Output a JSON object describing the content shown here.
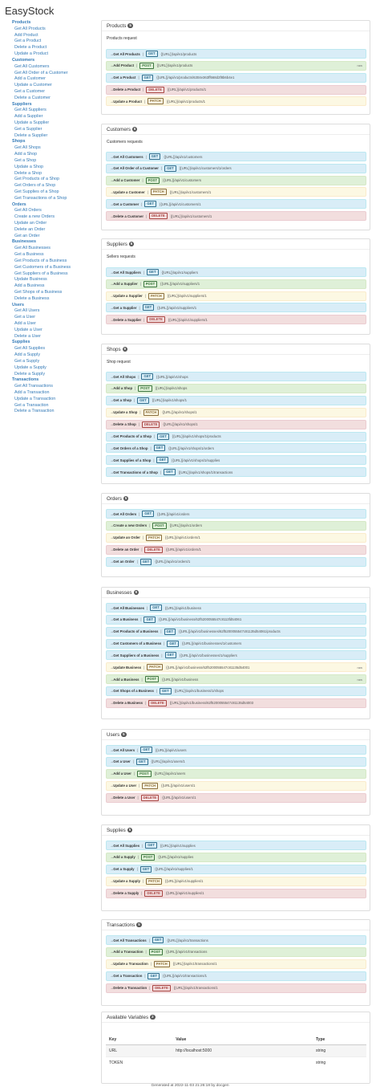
{
  "app_title": "EasyStock",
  "sidebar": [
    {
      "category": "Products",
      "items": [
        "Get All Products",
        "Add Product",
        "Get a Product",
        "Delete a Product",
        "Update a Product"
      ]
    },
    {
      "category": "Customers",
      "items": [
        "Get All Customers",
        "Get All Order of a Customer",
        "Add a Customer",
        "Update a Customer",
        "Get a Customer",
        "Delete a Customer"
      ]
    },
    {
      "category": "Suppliers",
      "items": [
        "Get All Suppliers",
        "Add a Supplier",
        "Update a Supplier",
        "Get a Supplier",
        "Delete a Supplier"
      ]
    },
    {
      "category": "Shops",
      "items": [
        "Get All Shops",
        "Add a Shop",
        "Get a Shop",
        "Update a Shop",
        "Delete a Shop",
        "Get Products of a Shop",
        "Get Orders of a Shop",
        "Get Supplies of a Shop",
        "Get Transactions of a Shop"
      ]
    },
    {
      "category": "Orders",
      "items": [
        "Get All Orders",
        "Create a new Orders",
        "Update an Order",
        "Delete an Order",
        "Get an Order"
      ]
    },
    {
      "category": "Businesses",
      "items": [
        "Get All Businesses",
        "Get a Business",
        "Get Products of a Business",
        "Get Customers of a Business",
        "Get Suppliers of a Business",
        "Update Business",
        "Add a Business",
        "Get Shops of a Business",
        "Delete a Business"
      ]
    },
    {
      "category": "Users",
      "items": [
        "Get All Users",
        "Get a User",
        "Add a User",
        "Update a User",
        "Delete a User"
      ]
    },
    {
      "category": "Supplies",
      "items": [
        "Get All Supplies",
        "Add a Supply",
        "Get a Supply",
        "Update a Supply",
        "Delete a Supply"
      ]
    },
    {
      "category": "Transactions",
      "items": [
        "Get All Transactions",
        "Add a Transaction",
        "Update a Transaction",
        "Get a Transaction",
        "Delete a Transaction"
      ]
    }
  ],
  "panels": [
    {
      "title": "Products",
      "count": "5",
      "group": "Products request",
      "requests": [
        {
          "name": "Get All Products",
          "method": "GET",
          "url": "{{URL}}/api/v1/products",
          "raw": ""
        },
        {
          "name": "Add Product",
          "method": "POST",
          "url": "{{URL}}/api/v1/products",
          "raw": "raw"
        },
        {
          "name": "Get a Product",
          "method": "GET",
          "url": "{{URL}}/api/v1/products/6304e363ff668d2f8b6b4e1",
          "raw": ""
        },
        {
          "name": "Delete a Product",
          "method": "DELETE",
          "url": "{{URL}}/api/v1/products/1",
          "raw": ""
        },
        {
          "name": "Update a Product",
          "method": "PATCH",
          "url": "{{URL}}/api/v1/products/1",
          "raw": ""
        }
      ]
    },
    {
      "title": "Customers",
      "count": "6",
      "group": "Customers requests",
      "requests": [
        {
          "name": "Get All Customers",
          "method": "GET",
          "url": "{{URL}}/api/v1/customers",
          "raw": ""
        },
        {
          "name": "Get All Order of a Customer",
          "method": "GET",
          "url": "{{URL}}/api/v1/customers/1/orders",
          "raw": ""
        },
        {
          "name": "Add a Customer",
          "method": "POST",
          "url": "{{URL}}/api/v1/customers",
          "raw": ""
        },
        {
          "name": "Update a Customer",
          "method": "PATCH",
          "url": "{{URL}}/api/v1/customers/1",
          "raw": ""
        },
        {
          "name": "Get a Customer",
          "method": "GET",
          "url": "{{URL}}/api/v1/customers/1",
          "raw": ""
        },
        {
          "name": "Delete a Customer",
          "method": "DELETE",
          "url": "{{URL}}/api/v1/customers/1",
          "raw": ""
        }
      ]
    },
    {
      "title": "Suppliers",
      "count": "5",
      "group": "Sellers requests",
      "requests": [
        {
          "name": "Get All Suppliers",
          "method": "GET",
          "url": "{{URL}}/api/v1/suppliers",
          "raw": ""
        },
        {
          "name": "Add a Supplier",
          "method": "POST",
          "url": "{{URL}}/api/v1/suppliers/1",
          "raw": ""
        },
        {
          "name": "Update a Supplier",
          "method": "PATCH",
          "url": "{{URL}}/api/v1/suppliers/1",
          "raw": ""
        },
        {
          "name": "Get a Supplier",
          "method": "GET",
          "url": "{{URL}}/api/v1/suppliers/1",
          "raw": ""
        },
        {
          "name": "Delete a Supplier",
          "method": "DELETE",
          "url": "{{URL}}/api/v1/suppliers/1",
          "raw": ""
        }
      ]
    },
    {
      "title": "Shops",
      "count": "9",
      "group": "Shop request",
      "requests": [
        {
          "name": "Get All Shops",
          "method": "GET",
          "url": "{{URL}}/api/v1/shops",
          "raw": ""
        },
        {
          "name": "Add a Shop",
          "method": "POST",
          "url": "{{URL}}/api/v1/shops",
          "raw": ""
        },
        {
          "name": "Get a Shop",
          "method": "GET",
          "url": "{{URL}}/api/v1/shops/1",
          "raw": ""
        },
        {
          "name": "Update a Shop",
          "method": "PATCH",
          "url": "{{URL}}/api/v1/shops/1",
          "raw": ""
        },
        {
          "name": "Delete a Shop",
          "method": "DELETE",
          "url": "{{URL}}/api/v1/shops/1",
          "raw": ""
        },
        {
          "name": "Get Products of a Shop",
          "method": "GET",
          "url": "{{URL}}/api/v1/shops/1/products",
          "raw": ""
        },
        {
          "name": "Get Orders of a Shop",
          "method": "GET",
          "url": "{{URL}}/api/v1/shops/1/orders",
          "raw": ""
        },
        {
          "name": "Get Supplies of a Shop",
          "method": "GET",
          "url": "{{URL}}/api/v1/shops/1/supplies",
          "raw": ""
        },
        {
          "name": "Get Transactions of a Shop",
          "method": "GET",
          "url": "{{URL}}/api/v1/shops/1/transactions",
          "raw": ""
        }
      ]
    },
    {
      "title": "Orders",
      "count": "5",
      "group": "",
      "requests": [
        {
          "name": "Get All Orders",
          "method": "GET",
          "url": "{{URL}}/api/v1/orders",
          "raw": ""
        },
        {
          "name": "Create a new Orders",
          "method": "POST",
          "url": "{{URL}}/api/v1/orders",
          "raw": ""
        },
        {
          "name": "Update an Order",
          "method": "PATCH",
          "url": "{{URL}}/api/v1/orders/1",
          "raw": ""
        },
        {
          "name": "Delete an Order",
          "method": "DELETE",
          "url": "{{URL}}/api/v1/orders/1",
          "raw": ""
        },
        {
          "name": "Get an Order",
          "method": "GET",
          "url": "{{URL}}/api/v1/orders/1",
          "raw": ""
        }
      ]
    },
    {
      "title": "Businesses",
      "count": "9",
      "group": "",
      "requests": [
        {
          "name": "Get All Businesses",
          "method": "GET",
          "url": "{{URL}}/api/v1/business",
          "raw": ""
        },
        {
          "name": "Get a Business",
          "method": "GET",
          "url": "{{URL}}/api/v1/business/62f5200055547c8113fd54061",
          "raw": ""
        },
        {
          "name": "Get Products of a Business",
          "method": "GET",
          "url": "{{URL}}/api/v1/businesses/62f5200055547c81135d54061/products",
          "raw": ""
        },
        {
          "name": "Get Customers of a Business",
          "method": "GET",
          "url": "{{URL}}/api/v1/businesses/1/customers",
          "raw": ""
        },
        {
          "name": "Get Suppliers of a Business",
          "method": "GET",
          "url": "{{URL}}/api/v1/businesses/1/suppliers",
          "raw": ""
        },
        {
          "name": "Update Business",
          "method": "PATCH",
          "url": "{{URL}}/api/v1/business/62f5200055547c81135d54001",
          "raw": "raw"
        },
        {
          "name": "Add a Business",
          "method": "POST",
          "url": "{{URL}}/api/v1/business",
          "raw": "raw"
        },
        {
          "name": "Get Shops of a Business",
          "method": "GET",
          "url": "{{URL}}/api/v1/business/1/shops",
          "raw": ""
        },
        {
          "name": "Delete a Business",
          "method": "DELETE",
          "url": "{{URL}}/api/v1/business/62f5200055547c81135d54003",
          "raw": ""
        }
      ]
    },
    {
      "title": "Users",
      "count": "5",
      "group": "",
      "requests": [
        {
          "name": "Get All Users",
          "method": "GET",
          "url": "{{URL}}/api/v1/users",
          "raw": ""
        },
        {
          "name": "Get a User",
          "method": "GET",
          "url": "{{URL}}/api/v1/users/1",
          "raw": ""
        },
        {
          "name": "Add a User",
          "method": "POST",
          "url": "{{URL}}/api/v1/users",
          "raw": ""
        },
        {
          "name": "Update a User",
          "method": "PATCH",
          "url": "{{URL}}/api/v1/users/1",
          "raw": ""
        },
        {
          "name": "Delete a User",
          "method": "DELETE",
          "url": "{{URL}}/api/v1/users/1",
          "raw": ""
        }
      ]
    },
    {
      "title": "Supplies",
      "count": "5",
      "group": "",
      "requests": [
        {
          "name": "Get All Supplies",
          "method": "GET",
          "url": "{{URL}}/api/v1/supplies",
          "raw": ""
        },
        {
          "name": "Add a Supply",
          "method": "POST",
          "url": "{{URL}}/api/v1/supplies",
          "raw": ""
        },
        {
          "name": "Get a Supply",
          "method": "GET",
          "url": "{{URL}}/api/v1/supplies/1",
          "raw": ""
        },
        {
          "name": "Update a Supply",
          "method": "PATCH",
          "url": "{{URL}}/api/v1/supplies/1",
          "raw": ""
        },
        {
          "name": "Delete a Supply",
          "method": "DELETE",
          "url": "{{URL}}/api/v1/supplies/1",
          "raw": ""
        }
      ]
    },
    {
      "title": "Transactions",
      "count": "5",
      "group": "",
      "requests": [
        {
          "name": "Get All Transactions",
          "method": "GET",
          "url": "{{URL}}/api/v1/transactions",
          "raw": ""
        },
        {
          "name": "Add a Transaction",
          "method": "POST",
          "url": "{{URL}}/api/v1/transactions",
          "raw": ""
        },
        {
          "name": "Update a Transaction",
          "method": "PATCH",
          "url": "{{URL}}/api/v1/transactions/1",
          "raw": ""
        },
        {
          "name": "Get a Transaction",
          "method": "GET",
          "url": "{{URL}}/api/v1/transactions/1",
          "raw": ""
        },
        {
          "name": "Delete a Transaction",
          "method": "DELETE",
          "url": "{{URL}}/api/v1/transactions/1",
          "raw": ""
        }
      ]
    }
  ],
  "variables": {
    "title": "Available Variables",
    "count": "2",
    "headers": [
      "Key",
      "Value",
      "Type"
    ],
    "rows": [
      [
        "URL",
        "http://localhost:5000",
        "string"
      ],
      [
        "TOKEN",
        "",
        "string"
      ]
    ]
  },
  "footer": "Generated at 2022-11-03 21:26:18 by docgen"
}
